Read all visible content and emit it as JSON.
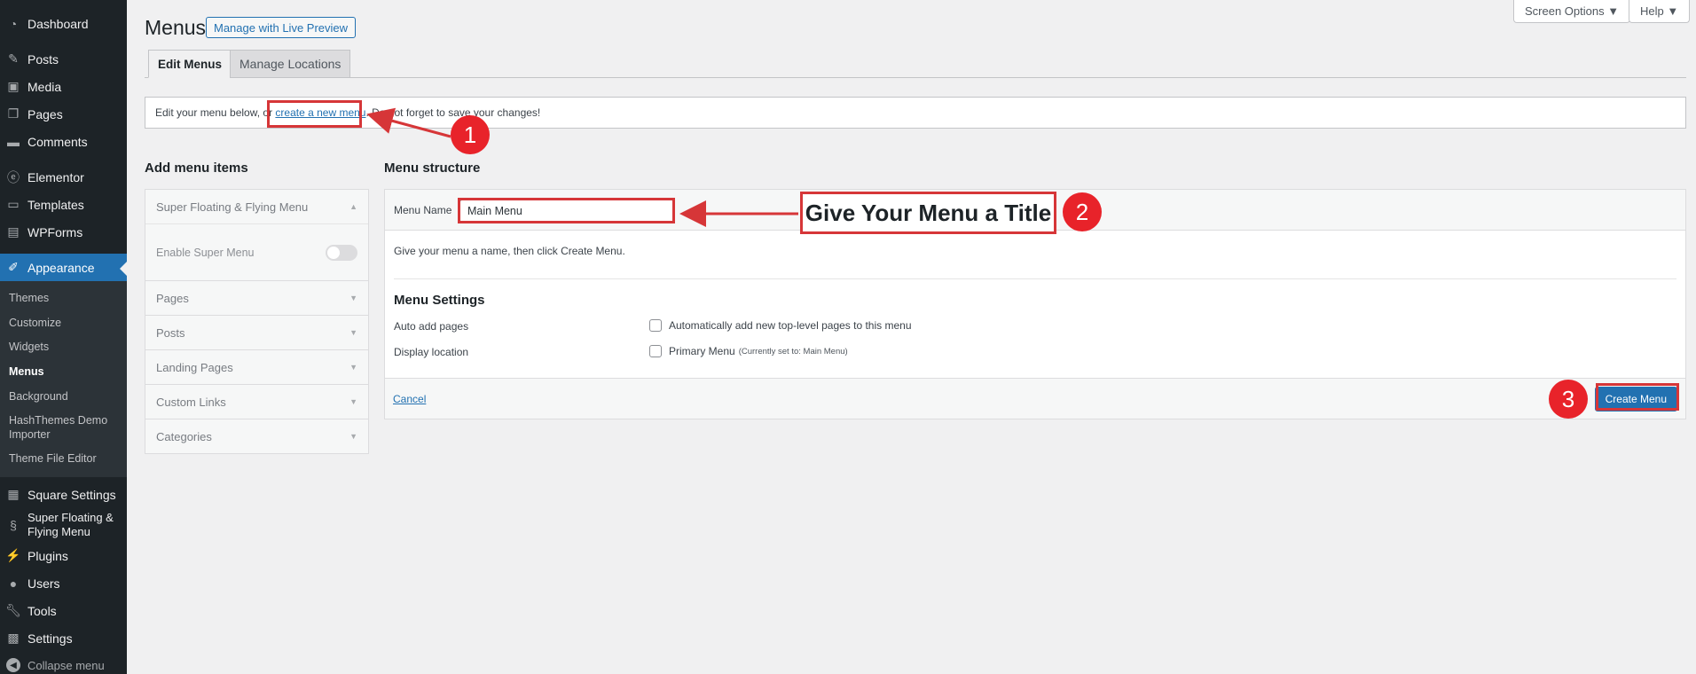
{
  "sidebar": {
    "top_items": [
      {
        "label": "Dashboard",
        "icon": "dashboard-icon"
      },
      {
        "label": "Posts",
        "icon": "pin-icon"
      },
      {
        "label": "Media",
        "icon": "media-icon"
      },
      {
        "label": "Pages",
        "icon": "pages-icon"
      },
      {
        "label": "Comments",
        "icon": "comment-icon"
      },
      {
        "label": "Elementor",
        "icon": "elementor-icon"
      },
      {
        "label": "Templates",
        "icon": "folder-icon"
      },
      {
        "label": "WPForms",
        "icon": "form-icon"
      }
    ],
    "active_item": {
      "label": "Appearance",
      "icon": "brush-icon"
    },
    "sub_items": [
      "Themes",
      "Customize",
      "Widgets",
      "Menus",
      "Background",
      "HashThemes Demo Importer",
      "Theme File Editor"
    ],
    "current_sub": "Menus",
    "bottom_items": [
      {
        "label": "Square Settings",
        "icon": "square-icon"
      },
      {
        "label": "Super Floating & Flying Menu",
        "icon": "s-icon"
      },
      {
        "label": "Plugins",
        "icon": "plug-icon"
      },
      {
        "label": "Users",
        "icon": "user-icon"
      },
      {
        "label": "Tools",
        "icon": "wrench-icon"
      },
      {
        "label": "Settings",
        "icon": "settings-icon"
      }
    ],
    "collapse_label": "Collapse menu"
  },
  "header": {
    "screen_options": "Screen Options ▼",
    "help": "Help ▼",
    "title": "Menus",
    "live_preview": "Manage with Live Preview"
  },
  "tabs": [
    {
      "label": "Edit Menus",
      "active": true
    },
    {
      "label": "Manage Locations",
      "active": false
    }
  ],
  "notice": {
    "prefix": "Edit your menu below, or ",
    "link": "create a new menu",
    "suffix": ". Do not forget to save your changes!"
  },
  "add_items": {
    "title": "Add menu items",
    "sections": [
      {
        "label": "Super Floating & Flying Menu",
        "expanded": true,
        "body_label": "Enable Super Menu"
      },
      {
        "label": "Pages"
      },
      {
        "label": "Posts"
      },
      {
        "label": "Landing Pages"
      },
      {
        "label": "Custom Links"
      },
      {
        "label": "Categories"
      }
    ]
  },
  "menu_structure": {
    "title": "Menu structure",
    "name_label": "Menu Name",
    "name_value": "Main Menu",
    "hint": "Give your menu a name, then click Create Menu.",
    "settings_title": "Menu Settings",
    "auto_add_label": "Auto add pages",
    "auto_add_option": "Automatically add new top-level pages to this menu",
    "display_location_label": "Display location",
    "primary_menu": "Primary Menu",
    "primary_note": "(Currently set to: Main Menu)",
    "cancel": "Cancel",
    "create": "Create Menu"
  },
  "annotations": {
    "callout": "Give Your Menu a Title",
    "step1": "1",
    "step2": "2",
    "step3": "3",
    "color": "#d63638"
  }
}
